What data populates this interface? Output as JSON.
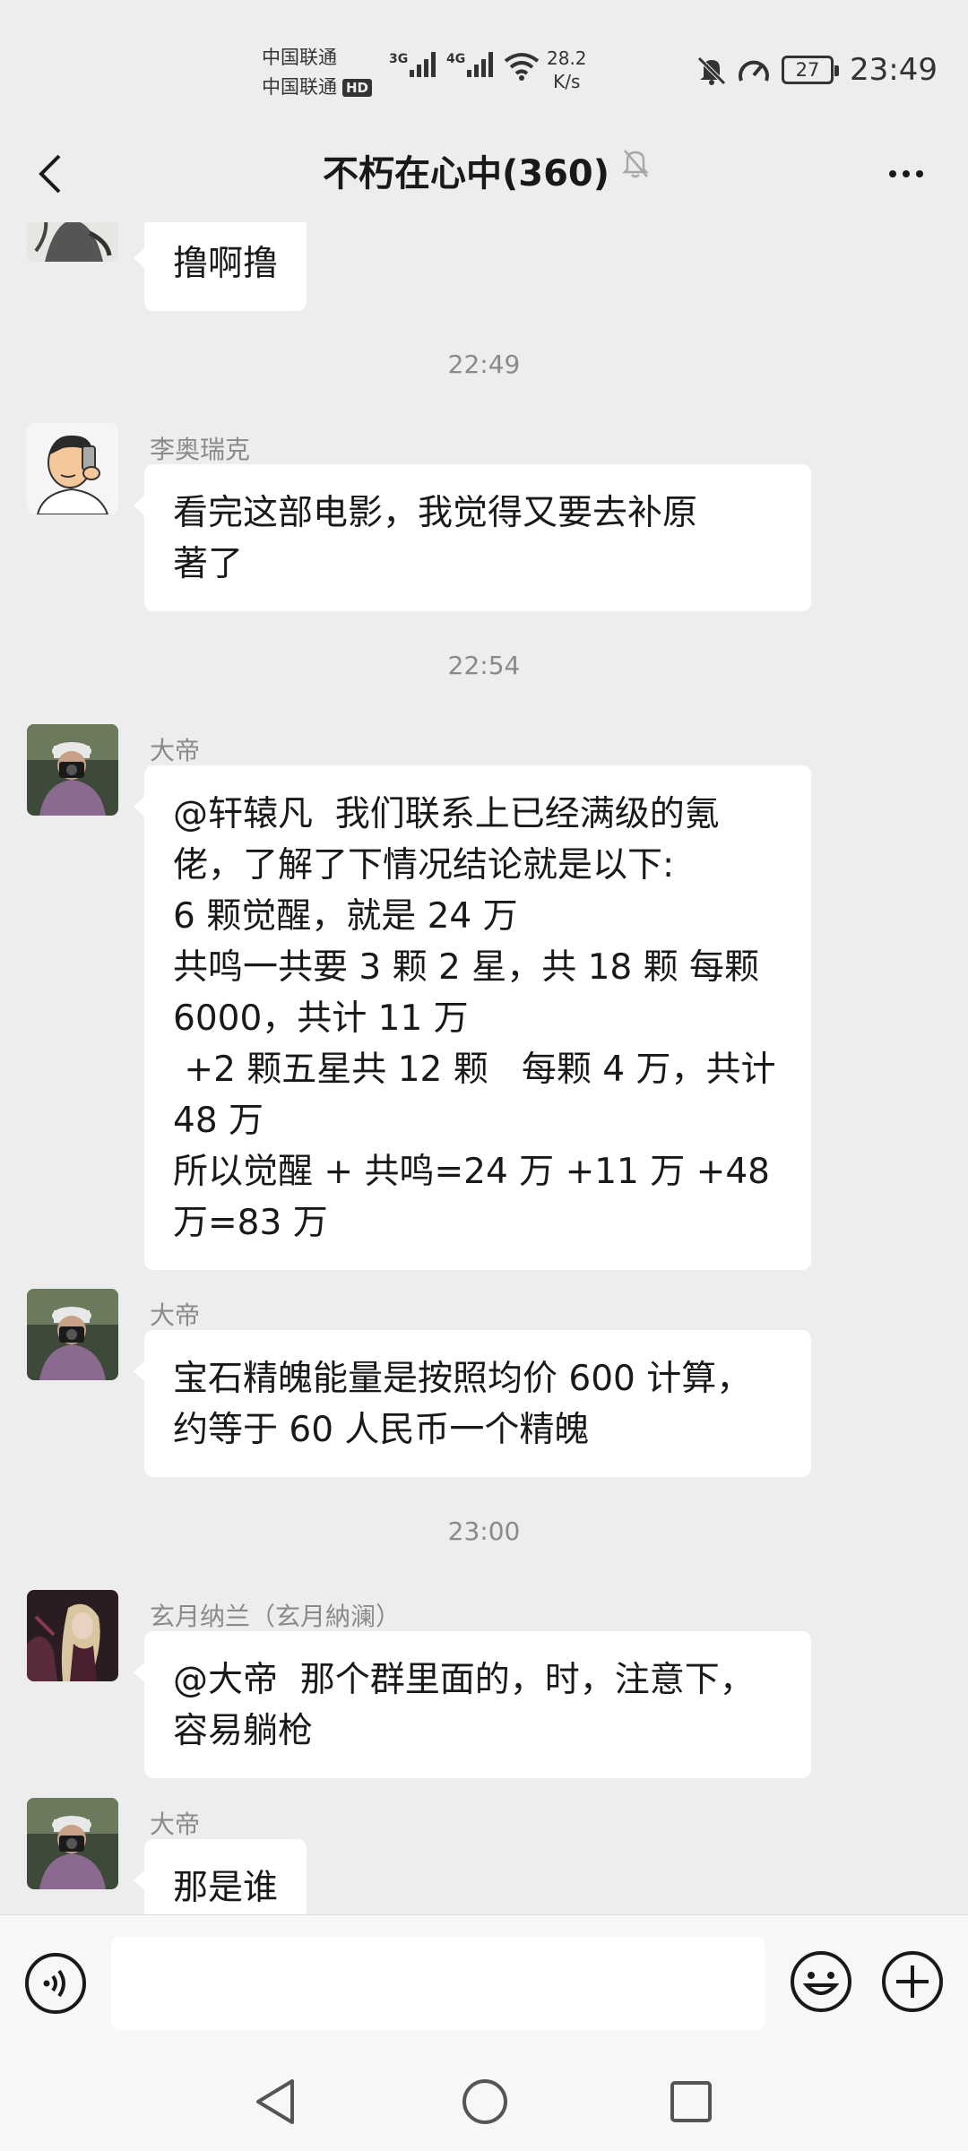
{
  "status_bar": {
    "carrier_1": "中国联通",
    "carrier_2": "中国联通",
    "hd_badge": "HD",
    "signal_1_label": "3G",
    "signal_2_label": "4G",
    "net_speed_value": "28.2",
    "net_speed_unit": "K/s",
    "battery": "27",
    "time": "23:49"
  },
  "header": {
    "title": "不朽在心中(360)"
  },
  "messages": [
    {
      "type": "message",
      "sender": "",
      "text": "撸啊撸",
      "avatar": "sketch-avatar"
    },
    {
      "type": "time",
      "text": "22:49"
    },
    {
      "type": "message",
      "sender": "李奥瑞克",
      "text": "看完这部电影，我觉得又要去补原\n著了",
      "avatar": "cartoon-selfie-avatar"
    },
    {
      "type": "time",
      "text": "22:54"
    },
    {
      "type": "message",
      "sender": "大帝",
      "text": "@轩辕凡  我们联系上已经满级的氪\n佬，了解了下情况结论就是以下:\n6 颗觉醒，就是 24 万\n共鸣一共要 3 颗 2 星，共 18 颗 每颗\n6000，共计 11 万\n +2 颗五星共 12 颗   每颗 4 万，共计\n48 万\n所以觉醒 + 共鸣=24 万 +11 万 +48\n万=83 万",
      "avatar": "camera-photographer-avatar"
    },
    {
      "type": "message",
      "sender": "大帝",
      "text": "宝石精魄能量是按照均价 600 计算，\n约等于 60 人民币一个精魄",
      "avatar": "camera-photographer-avatar"
    },
    {
      "type": "time",
      "text": "23:00"
    },
    {
      "type": "message",
      "sender": "玄月纳兰（玄月納澜）",
      "text": "@大帝  那个群里面的，时，注意下，\n容易躺枪",
      "avatar": "game-character-avatar"
    },
    {
      "type": "message",
      "sender": "大帝",
      "text": "那是谁",
      "avatar": "camera-photographer-avatar"
    }
  ],
  "input": {
    "placeholder": ""
  },
  "colors": {
    "background": "#ededed",
    "bubble": "#ffffff",
    "text": "#191919",
    "meta_text": "#8a8a8a"
  }
}
